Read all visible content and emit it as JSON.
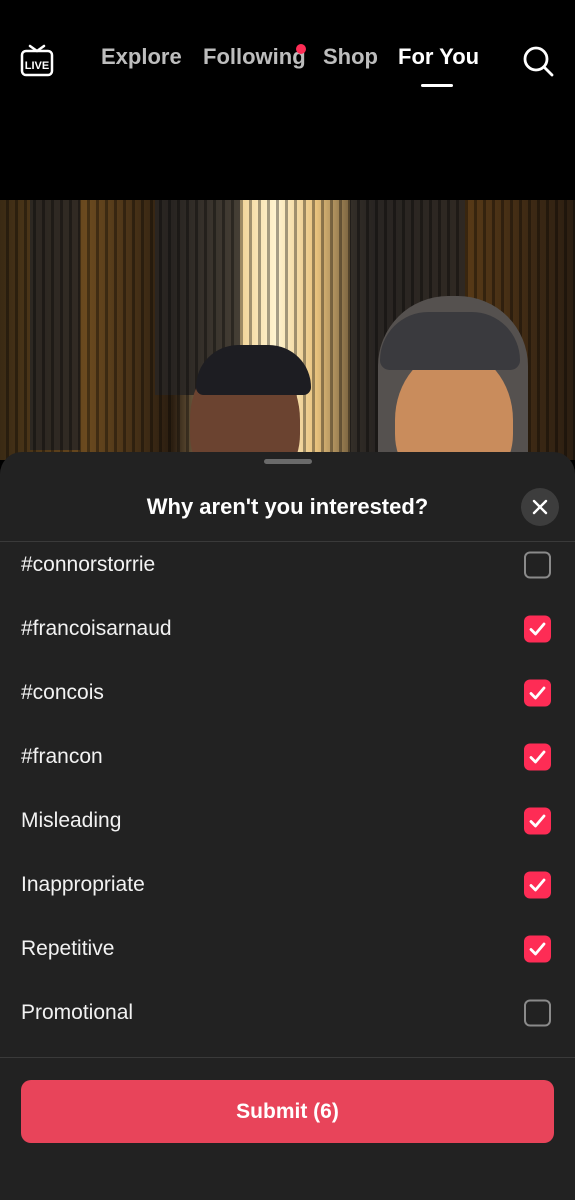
{
  "nav": {
    "live_label": "LIVE",
    "tabs": [
      {
        "label": "Explore"
      },
      {
        "label": "Following"
      },
      {
        "label": "Shop"
      },
      {
        "label": "For You"
      }
    ],
    "active_tab": "For You",
    "accent_color": "#fe2c55"
  },
  "sheet": {
    "title": "Why aren't you interested?",
    "options": [
      {
        "label": "#connorstorrie",
        "checked": false
      },
      {
        "label": "#francoisarnaud",
        "checked": true
      },
      {
        "label": "#concois",
        "checked": true
      },
      {
        "label": "#francon",
        "checked": true
      },
      {
        "label": "Misleading",
        "checked": true
      },
      {
        "label": "Inappropriate",
        "checked": true
      },
      {
        "label": "Repetitive",
        "checked": true
      },
      {
        "label": "Promotional",
        "checked": false
      }
    ],
    "submit_label": "Submit (6)",
    "submit_color": "#e8445a"
  }
}
